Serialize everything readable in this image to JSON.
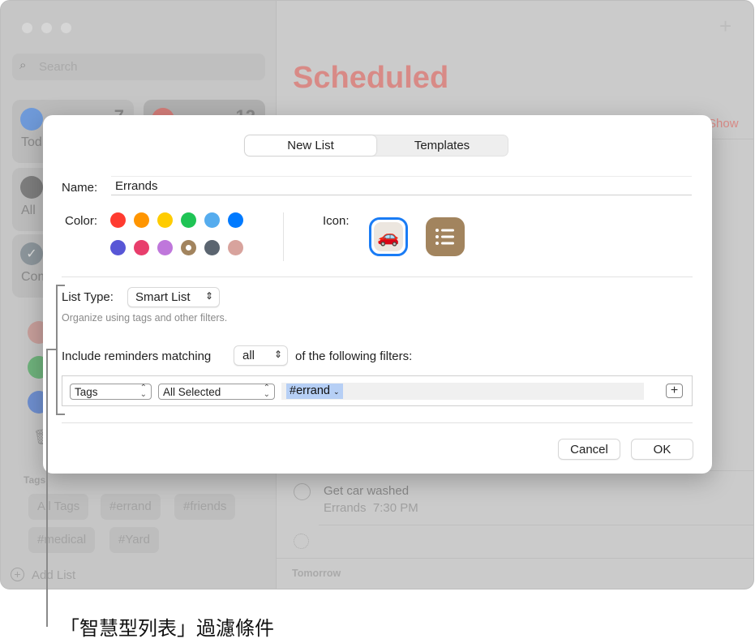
{
  "sidebar": {
    "search_placeholder": "Search",
    "cards": [
      {
        "label": "Tod",
        "count": "7"
      },
      {
        "label": "",
        "count": "12"
      },
      {
        "label": "All"
      },
      {
        "label": "Com"
      }
    ],
    "tags_heading": "Tags",
    "tags": [
      "All Tags",
      "#errand",
      "#friends",
      "#medical",
      "#Yard"
    ],
    "add_list": "Add List"
  },
  "main": {
    "title": "Scheduled",
    "show_link": "Show",
    "add_icon": "plus-icon",
    "reminder": {
      "title": "Get car washed",
      "list": "Errands",
      "time": "7:30 PM"
    },
    "section": "Tomorrow"
  },
  "dialog": {
    "tabs": [
      "New List",
      "Templates"
    ],
    "selected_tab": "New List",
    "name_label": "Name:",
    "name_value": "Errands",
    "color_label": "Color:",
    "colors": [
      "#ff3b30",
      "#ff9500",
      "#ffcc00",
      "#1fc455",
      "#55acee",
      "#007aff",
      "#5856d6",
      "#e83e6c",
      "#bf77db",
      "#a2845e",
      "#5b6570",
      "#d8a39d"
    ],
    "selected_color": "#a2845e",
    "icon_label": "Icon:",
    "icons": [
      {
        "name": "car-emoji",
        "glyph": "🚗",
        "selected": true
      },
      {
        "name": "list-icon",
        "selected": false
      }
    ],
    "list_type_label": "List Type:",
    "list_type_value": "Smart List",
    "list_type_hint": "Organize using tags and other filters.",
    "include_label": "Include reminders matching",
    "match_value": "all",
    "following_label": "of the following filters:",
    "filter": {
      "field": "Tags",
      "mode": "All Selected",
      "token": "#errand"
    },
    "cancel": "Cancel",
    "ok": "OK"
  },
  "callout": "「智慧型列表」過濾條件"
}
